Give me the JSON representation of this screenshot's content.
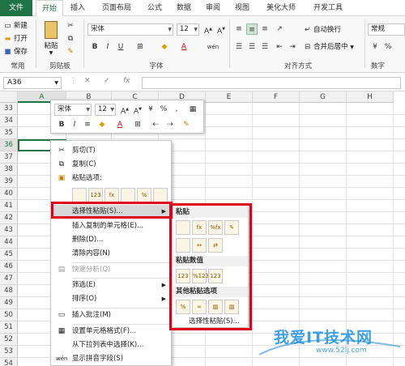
{
  "ribbon": {
    "tabs": [
      "文件",
      "开始",
      "插入",
      "页面布局",
      "公式",
      "数据",
      "审阅",
      "视图",
      "美化大师",
      "开发工具"
    ],
    "active_tab": "开始",
    "common_group": {
      "label": "常用",
      "new": "新建",
      "open": "打开",
      "save": "保存"
    },
    "clipboard_group": {
      "label": "剪贴板",
      "paste": "粘贴"
    },
    "font_group": {
      "label": "字体",
      "font_name": "宋体",
      "font_size": "12",
      "bold": "B",
      "italic": "I",
      "underline": "U",
      "wen": "wén"
    },
    "align_group": {
      "label": "对齐方式",
      "wrap": "自动换行",
      "merge": "合并后居中"
    },
    "number_group": {
      "label": "数字",
      "format": "常规"
    },
    "accent_color": "#217346"
  },
  "formula_bar": {
    "name_box": "A36",
    "cancel": "✕",
    "enter": "✓",
    "fx": "fx"
  },
  "grid": {
    "columns": [
      "A",
      "B",
      "C",
      "D",
      "E",
      "F",
      "G",
      "H"
    ],
    "rows": [
      "33",
      "34",
      "35",
      "36",
      "37",
      "38",
      "39",
      "40",
      "41",
      "42",
      "43",
      "44",
      "45",
      "46",
      "47",
      "48",
      "49",
      "50",
      "51",
      "52",
      "53",
      "54"
    ],
    "active_cell": "A36"
  },
  "mini_toolbar": {
    "font": "宋体",
    "size": "12",
    "percent": "%",
    "comma": ",",
    "bold": "B",
    "italic": "I",
    "currency": "¥"
  },
  "context_menu": {
    "cut": "剪切(T)",
    "copy": "复制(C)",
    "paste_options": "粘贴选项:",
    "paste_special": "选择性粘贴(S)...",
    "insert_copied": "插入复制的单元格(E)...",
    "delete": "删除(D)...",
    "clear": "清除内容(N)",
    "quick_analysis": "快速分析(Q)",
    "filter": "筛选(E)",
    "sort": "排序(O)",
    "insert_comment": "插入批注(M)",
    "format_cells": "设置单元格格式(F)...",
    "pick_list": "从下拉列表中选择(K)...",
    "phonetic": "显示拼音字段(S)",
    "paste_icon_labels": [
      "",
      "123",
      "fx",
      "",
      "%",
      ""
    ]
  },
  "paste_submenu": {
    "paste_header": "粘贴",
    "paste_values_header": "粘贴数值",
    "other_header": "其他粘贴选项",
    "paste_special": "选择性粘贴(S)...",
    "value_icon_labels": [
      "123",
      "%123",
      "123"
    ]
  },
  "watermark": {
    "main": "我爱IT技术网",
    "sub": "www.52ij.com"
  }
}
